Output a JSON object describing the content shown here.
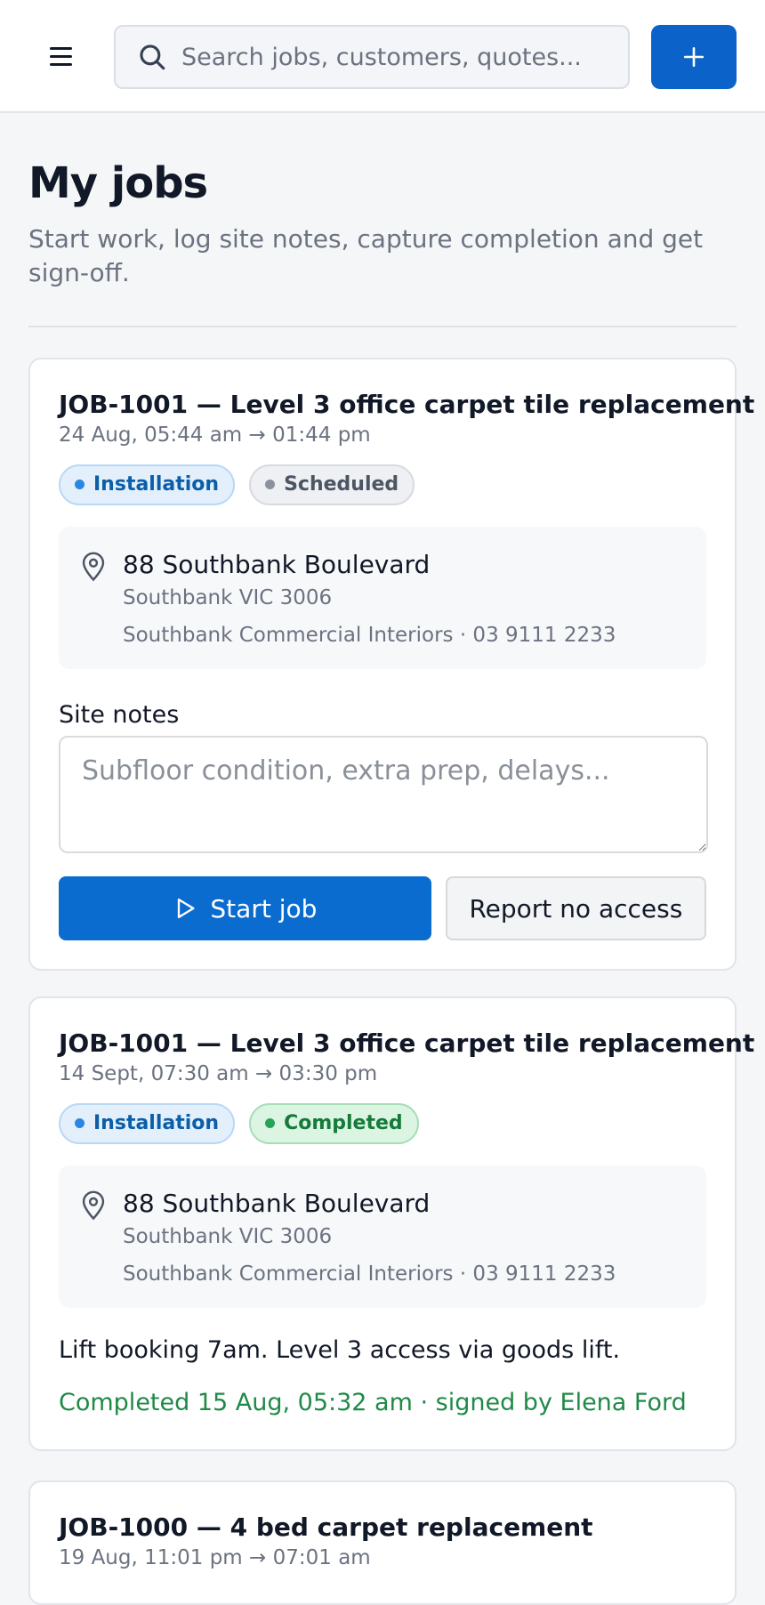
{
  "header": {
    "search_placeholder": "Search jobs, customers, quotes..."
  },
  "page": {
    "title": "My jobs",
    "subtitle": "Start work, log site notes, capture completion and get sign-off."
  },
  "jobs": [
    {
      "title": "JOB-1001 — Level 3 office carpet tile replacement",
      "time": "24 Aug, 05:44 am → 01:44 pm",
      "type_chip": "Installation",
      "status_chip": "Scheduled",
      "street": "88 Southbank Boulevard",
      "suburb": "Southbank VIC 3006",
      "contact": "Southbank Commercial Interiors · 03 9111 2233",
      "notes_label": "Site notes",
      "notes_placeholder": "Subfloor condition, extra prep, delays...",
      "start_label": "Start job",
      "no_access_label": "Report no access"
    },
    {
      "title": "JOB-1001 — Level 3 office carpet tile replacement",
      "time": "14 Sept, 07:30 am → 03:30 pm",
      "type_chip": "Installation",
      "status_chip": "Completed",
      "street": "88 Southbank Boulevard",
      "suburb": "Southbank VIC 3006",
      "contact": "Southbank Commercial Interiors · 03 9111 2233",
      "note_text": "Lift booking 7am. Level 3 access via goods lift.",
      "completed_text": "Completed 15 Aug, 05:32 am · signed by Elena Ford"
    },
    {
      "title": "JOB-1000 — 4 bed carpet replacement",
      "time": "19 Aug, 11:01 pm → 07:01 am"
    }
  ],
  "colors": {
    "primary": "#0b6ccf",
    "success": "#1f8a47"
  }
}
